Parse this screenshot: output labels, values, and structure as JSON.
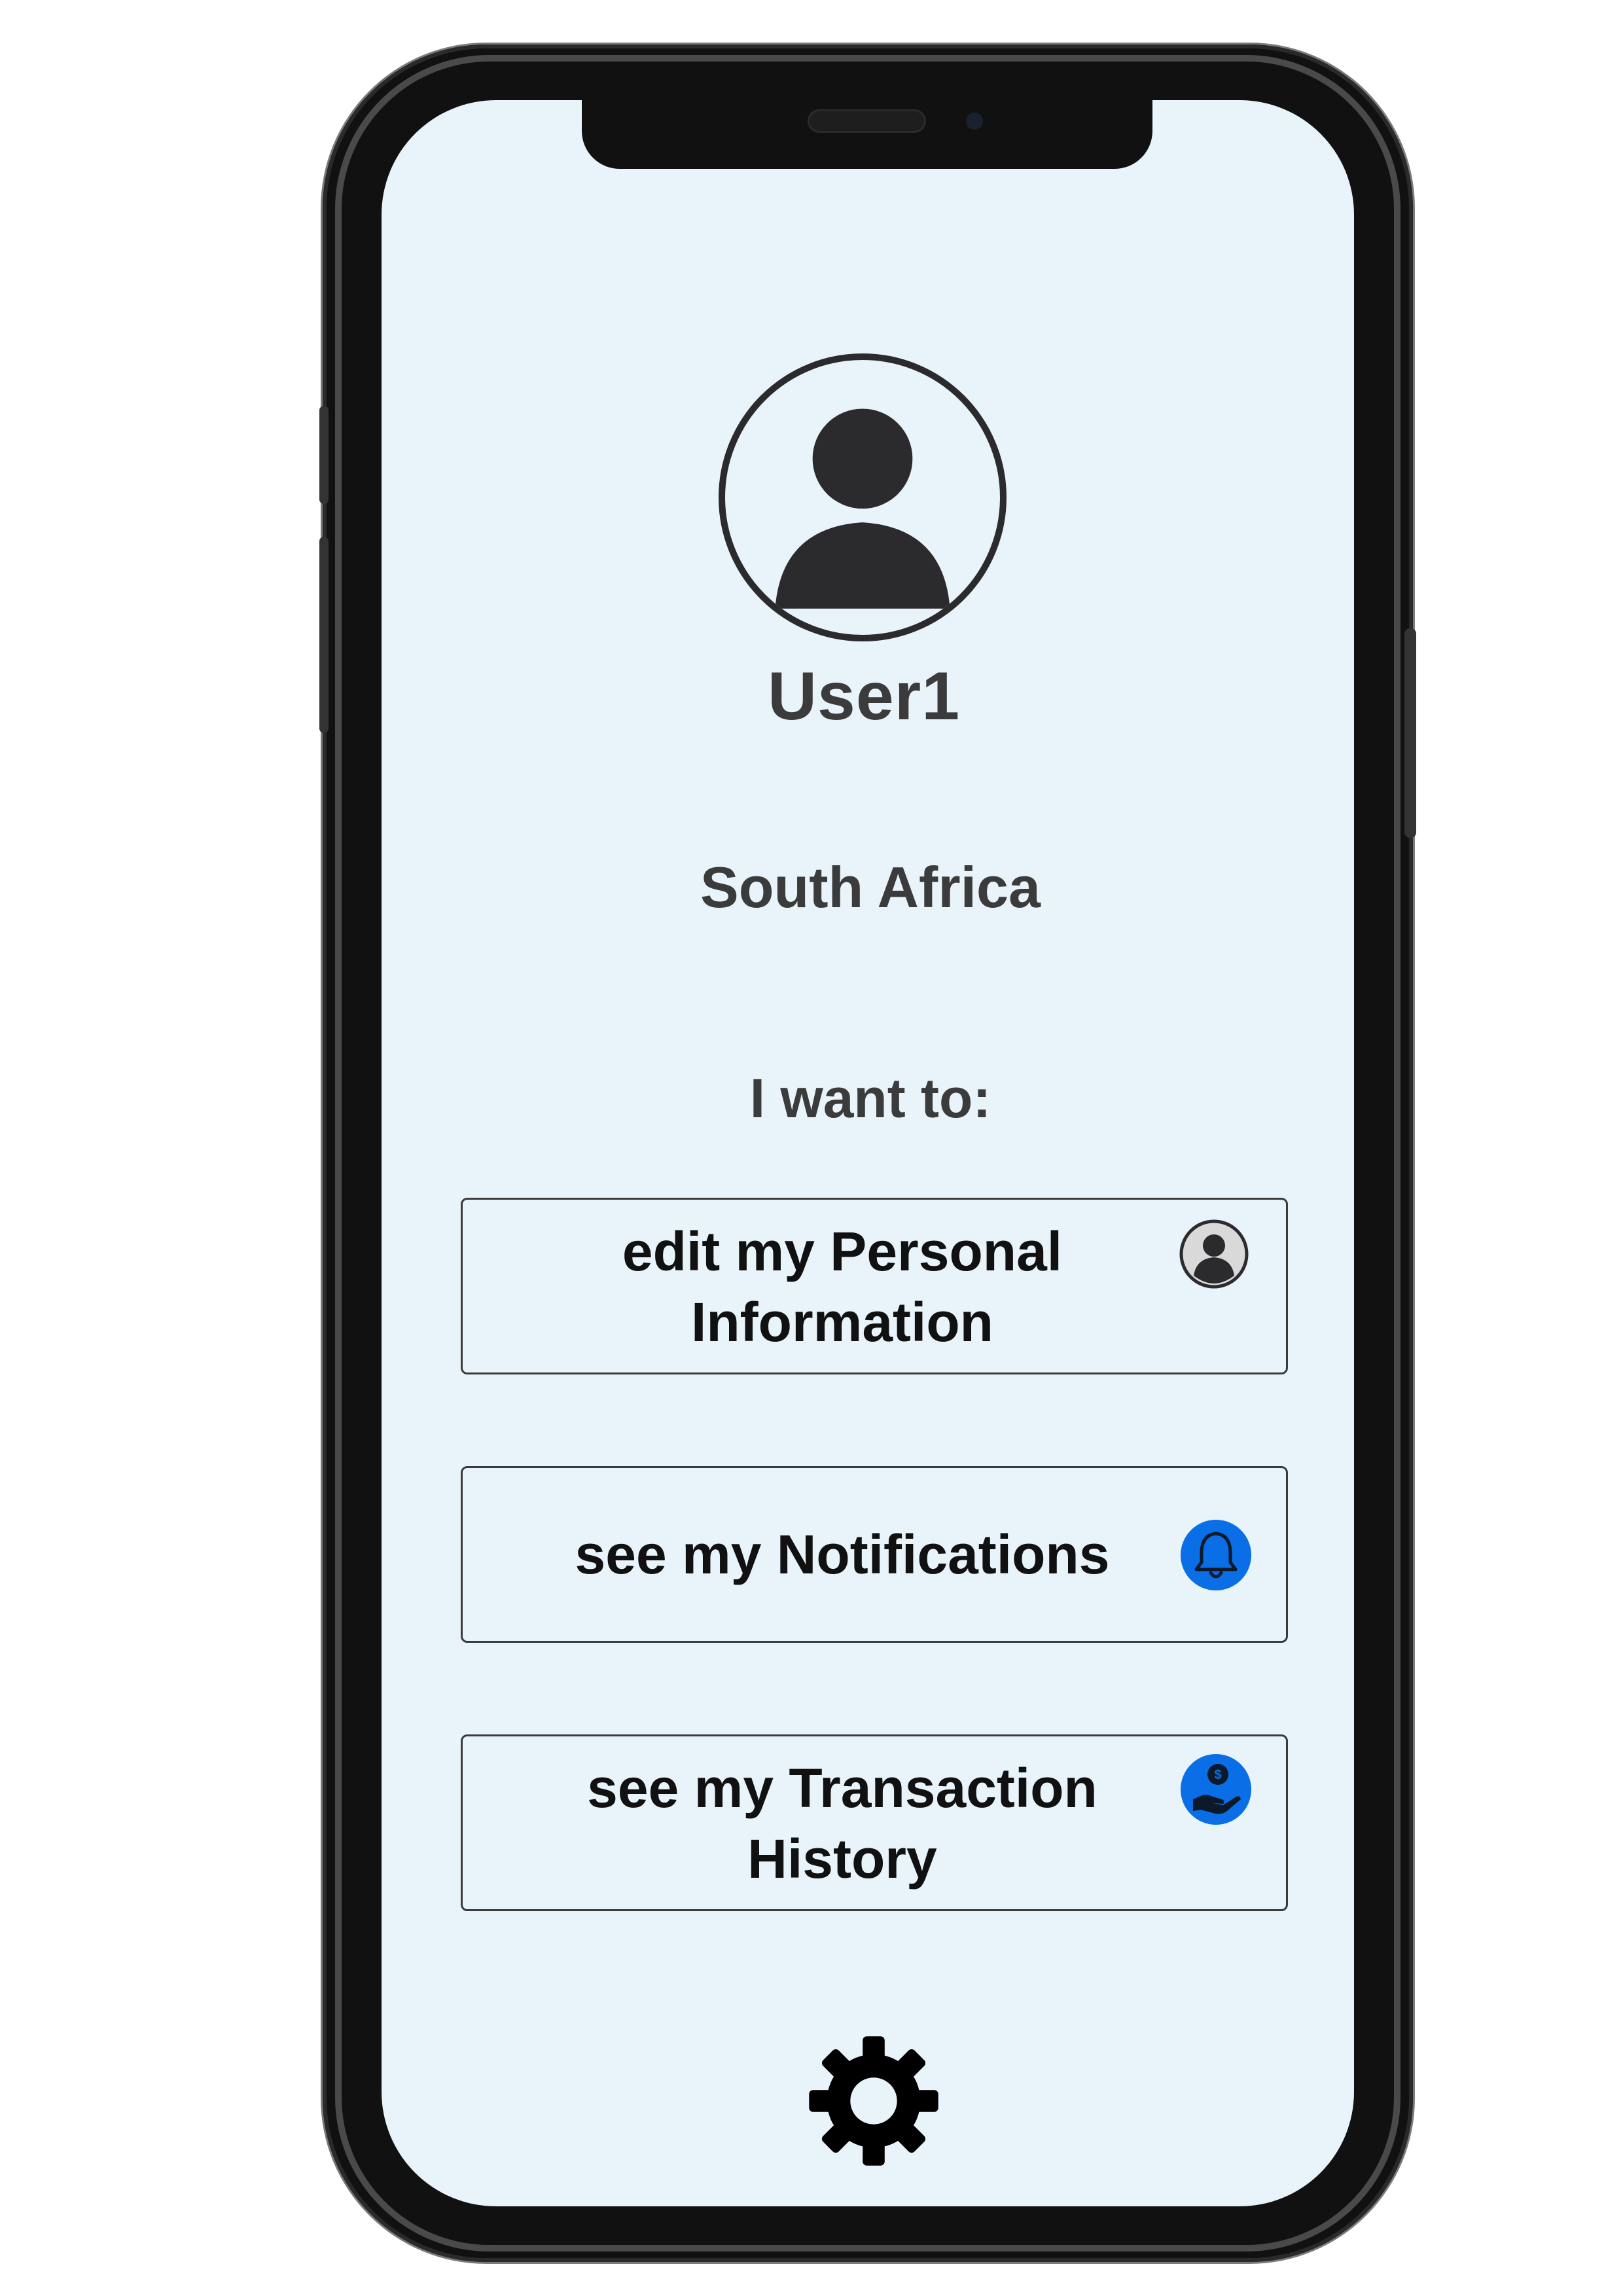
{
  "profile": {
    "username": "User1",
    "country": "South Africa",
    "avatar_icon": "user-avatar-icon"
  },
  "menu": {
    "prompt": "I want to:",
    "actions": [
      {
        "label": "edit my Personal Information",
        "line1": "edit my Personal",
        "line2": "Information",
        "icon": "user-circle-icon"
      },
      {
        "label": "see my Notifications",
        "line1": "see my Notifications",
        "line2": "",
        "icon": "bell-icon",
        "icon_color": "#0a6ee6"
      },
      {
        "label": "see my Transaction History",
        "line1": "see my Transaction",
        "line2": "History",
        "icon": "money-hand-icon",
        "icon_color": "#0a6ee6"
      }
    ]
  },
  "footer": {
    "settings_icon": "gear-icon"
  },
  "colors": {
    "screen_background": "#e9f3fa",
    "accent_blue": "#0a6ee6",
    "text_dark": "#3b3b3b"
  }
}
